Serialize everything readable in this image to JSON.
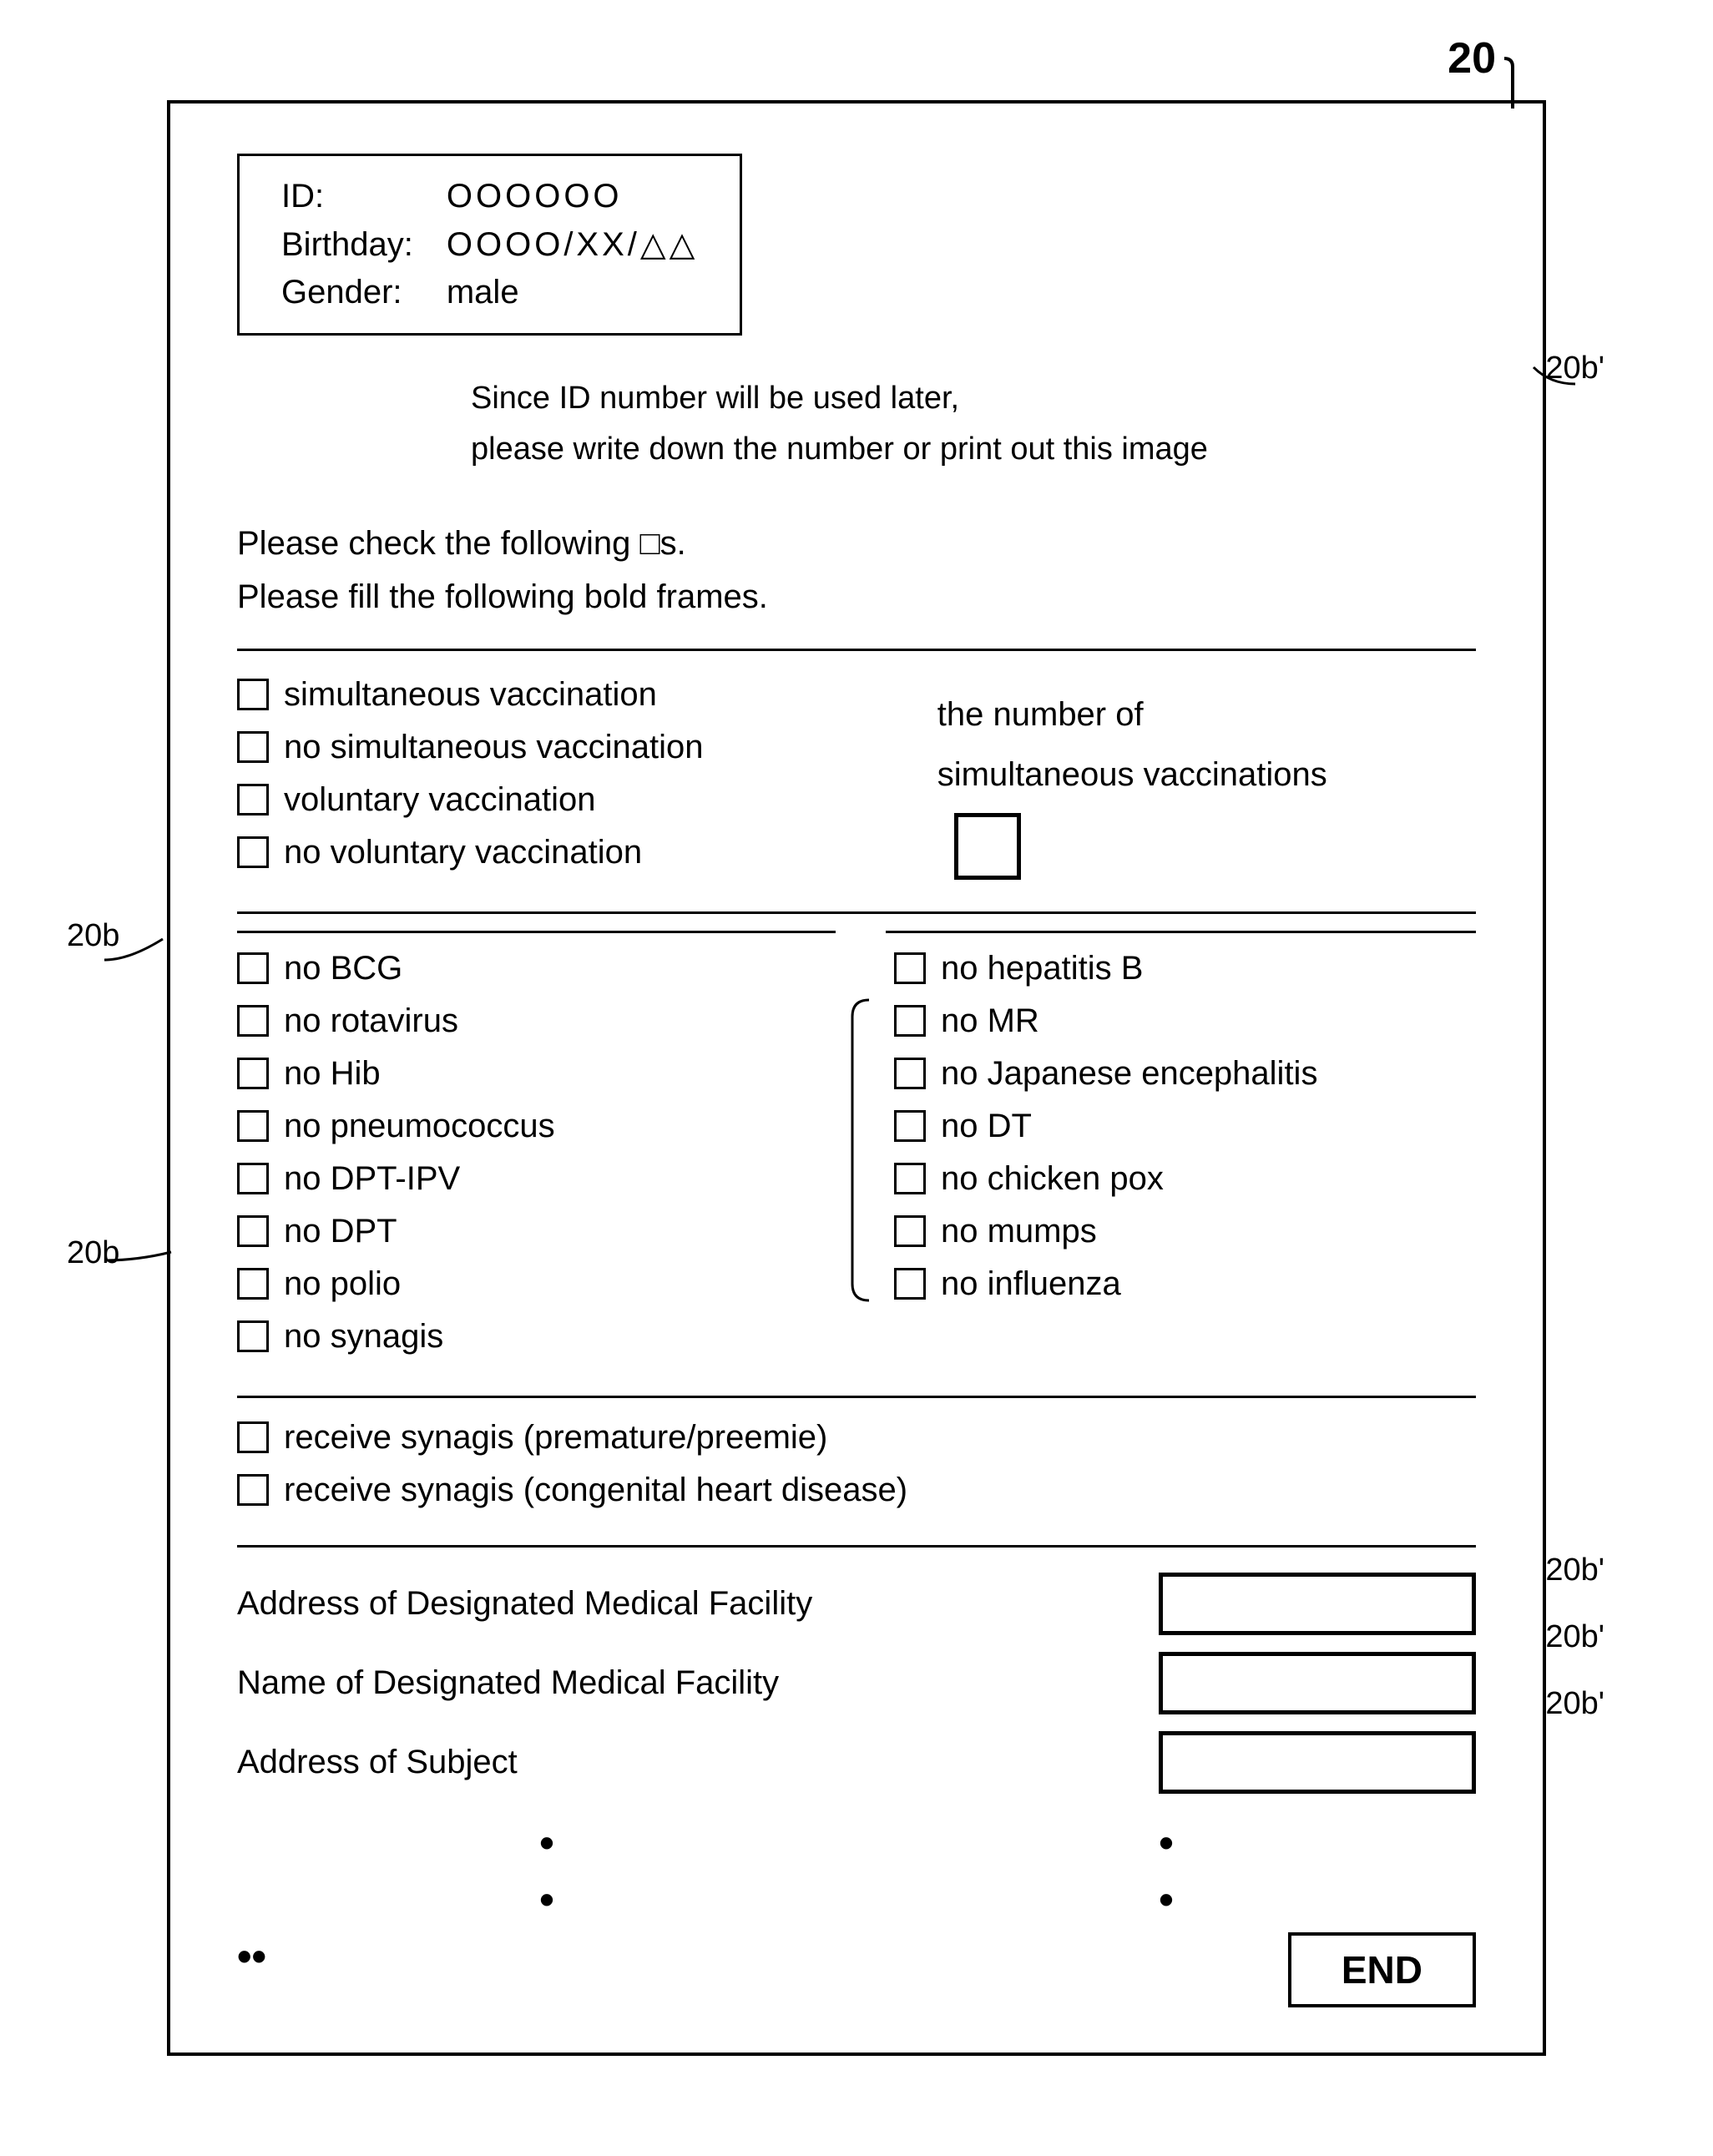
{
  "ref_number": "20",
  "ref_20b_prime_top": "20b'",
  "ref_20b_left_top": "20b",
  "ref_20b_left_bottom": "20b",
  "ref_20b_prime_facility1": "20b'",
  "ref_20b_prime_facility2": "20b'",
  "ref_20b_prime_facility3": "20b'",
  "id_box": {
    "id_label": "ID:",
    "id_value": "OOOOOO",
    "birthday_label": "Birthday:",
    "birthday_value": "OOOO/XX/△△",
    "gender_label": "Gender:",
    "gender_value": "male"
  },
  "info_text": {
    "line1": "Since ID number will be used later,",
    "line2": "please write down the number or print out this image"
  },
  "instruction": {
    "line1": "Please check the following □s.",
    "line2": "Please fill the following bold frames."
  },
  "vaccination_section": {
    "items": [
      "simultaneous vaccination",
      "no simultaneous vaccination",
      "voluntary vaccination",
      "no voluntary vaccination"
    ],
    "count_label_line1": "the number of",
    "count_label_line2": "simultaneous vaccinations"
  },
  "no_vax_left": [
    "no BCG",
    "no rotavirus",
    "no Hib",
    "no pneumococcus",
    "no DPT-IPV",
    "no DPT",
    "no polio",
    "no synagis"
  ],
  "no_vax_right": [
    "no hepatitis B",
    "no MR",
    "no Japanese encephalitis",
    "no DT",
    "no chicken pox",
    "no mumps",
    "no influenza"
  ],
  "synagis_items": [
    "receive synagis (premature/preemie)",
    "receive synagis (congenital heart disease)"
  ],
  "facility_section": {
    "rows": [
      "Address of Designated Medical Facility",
      "Name of Designated Medical Facility",
      "Address of Subject"
    ]
  },
  "end_button": "END"
}
